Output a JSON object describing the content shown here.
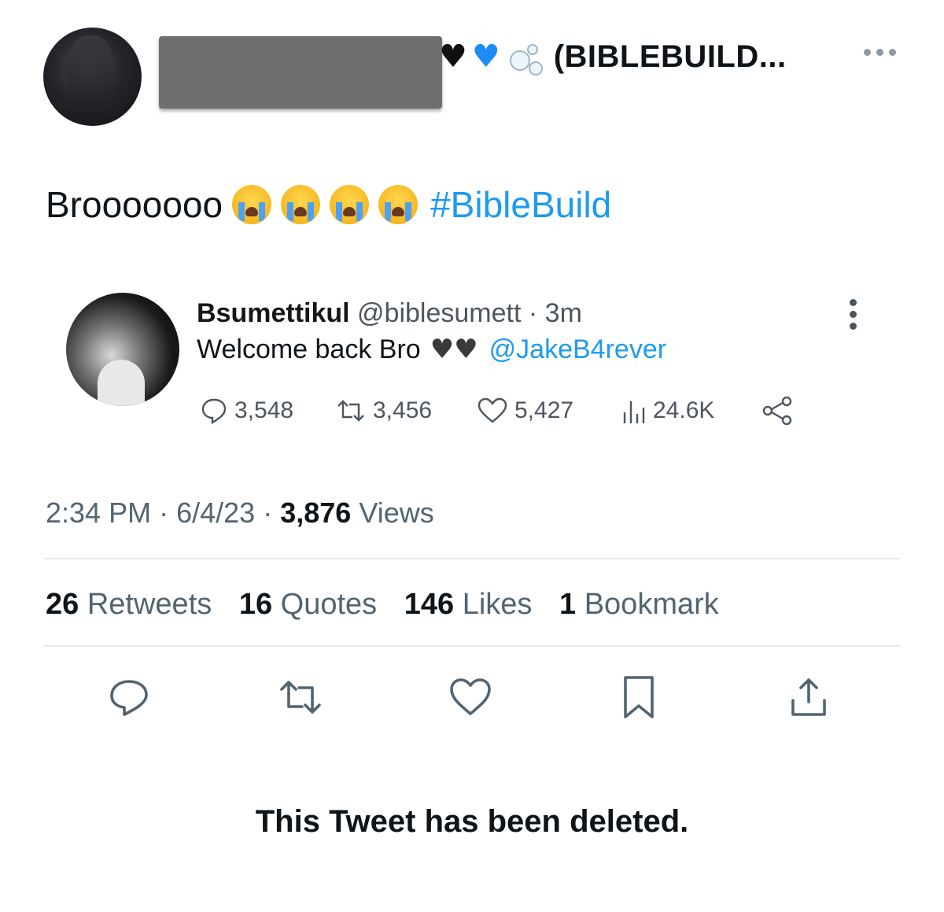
{
  "tweet": {
    "author_display_suffix": "(BIBLEBUILD...",
    "text": "Brooooooo",
    "hashtag": "#BibleBuild",
    "timestamp": "2:34 PM",
    "date": "6/4/23",
    "views_count": "3,876",
    "views_label": "Views",
    "separator": "·"
  },
  "quoted": {
    "name": "Bsumettikul",
    "handle": "@biblesumett",
    "time": "3m",
    "text": "Welcome back Bro",
    "mention": "@JakeB4rever",
    "replies": "3,548",
    "retweets": "3,456",
    "likes": "5,427",
    "views": "24.6K"
  },
  "engagement": {
    "retweets_count": "26",
    "retweets_label": "Retweets",
    "quotes_count": "16",
    "quotes_label": "Quotes",
    "likes_count": "146",
    "likes_label": "Likes",
    "bookmarks_count": "1",
    "bookmarks_label": "Bookmark"
  },
  "status_message": "This Tweet has been deleted.",
  "colors": {
    "link": "#1d9bf0",
    "muted": "#536471",
    "text": "#0f1419"
  }
}
